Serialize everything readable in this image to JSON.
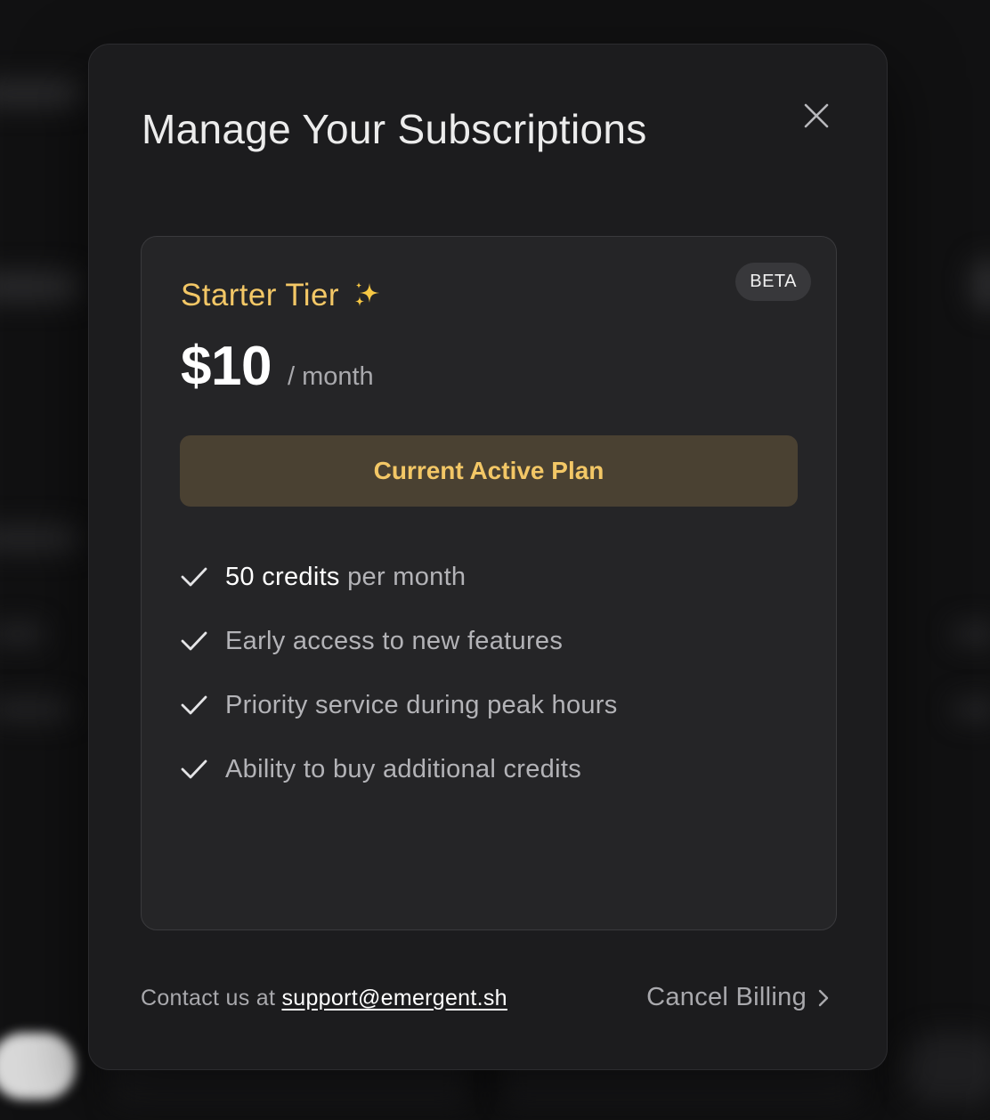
{
  "modal": {
    "title": "Manage Your Subscriptions",
    "close_icon": "close-icon"
  },
  "plan": {
    "tier_name": "Starter Tier",
    "tier_icon": "sparkles-icon",
    "badge": "BETA",
    "price": "$10",
    "period": "/ month",
    "status_button": "Current Active Plan",
    "features": [
      {
        "strong": "50 credits",
        "text": " per month"
      },
      {
        "strong": "",
        "text": "Early access to new features"
      },
      {
        "strong": "",
        "text": "Priority service during peak hours"
      },
      {
        "strong": "",
        "text": "Ability to buy additional credits"
      }
    ]
  },
  "footer": {
    "contact_prefix": "Contact us at ",
    "support_email": "support@emergent.sh",
    "cancel_label": "Cancel Billing"
  },
  "colors": {
    "accent_gold": "#f3c766",
    "active_button_bg": "#4a4132",
    "modal_bg": "#1c1c1e",
    "card_bg": "#252527"
  }
}
